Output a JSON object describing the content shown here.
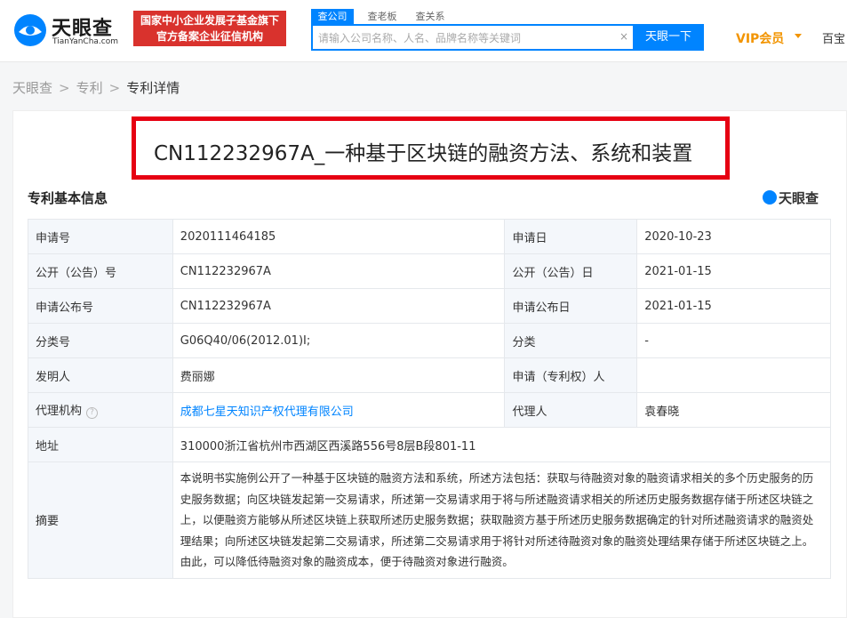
{
  "header": {
    "logo_title": "天眼查",
    "logo_sub": "TianYanCha.com",
    "slogan_line1": "国家中小企业发展子基金旗下",
    "slogan_line2": "官方备案企业征信机构",
    "tabs": [
      "查公司",
      "查老板",
      "查关系"
    ],
    "search_placeholder": "请输入公司名称、人名、品牌名称等关键词",
    "clear_icon": "×",
    "search_button": "天眼一下",
    "vip_label": "VIP会员",
    "baike_label": "百宝"
  },
  "breadcrumb": [
    "天眼查",
    "专利",
    "专利详情"
  ],
  "patent_title": "CN112232967A_一种基于区块链的融资方法、系统和装置",
  "section_title": "专利基本信息",
  "brand_label": "天眼查",
  "fields": {
    "app_no_label": "申请号",
    "app_no": "2020111464185",
    "app_date_label": "申请日",
    "app_date": "2020-10-23",
    "pub_no_label": "公开（公告）号",
    "pub_no": "CN112232967A",
    "pub_date_label": "公开（公告）日",
    "pub_date": "2021-01-15",
    "announce_no_label": "申请公布号",
    "announce_no": "CN112232967A",
    "announce_date_label": "申请公布日",
    "announce_date": "2021-01-15",
    "class_no_label": "分类号",
    "class_no": "G06Q40/06(2012.01)I;",
    "category_label": "分类",
    "category": "-",
    "inventor_label": "发明人",
    "inventor": "费丽娜",
    "applicant_label": "申请（专利权）人",
    "applicant": "",
    "agency_label": "代理机构",
    "agency": "成都七星天知识产权代理有限公司",
    "agent_label": "代理人",
    "agent": "袁春晓",
    "address_label": "地址",
    "address": "310000浙江省杭州市西湖区西溪路556号8层B段801-11",
    "abstract_label": "摘要",
    "abstract": "本说明书实施例公开了一种基于区块链的融资方法和系统，所述方法包括：获取与待融资对象的融资请求相关的多个历史服务的历史服务数据；向区块链发起第一交易请求，所述第一交易请求用于将与所述融资请求相关的所述历史服务数据存储于所述区块链之上，以便融资方能够从所述区块链上获取所述历史服务数据；获取融资方基于所述历史服务数据确定的针对所述融资请求的融资处理结果；向所述区块链发起第二交易请求，所述第二交易请求用于将针对所述待融资对象的融资处理结果存储于所述区块链之上。由此，可以降低待融资对象的融资成本，便于待融资对象进行融资。"
  },
  "colors": {
    "brand_blue": "#0084ff",
    "highlight_red": "#e60012",
    "vip_orange": "#f29400"
  }
}
